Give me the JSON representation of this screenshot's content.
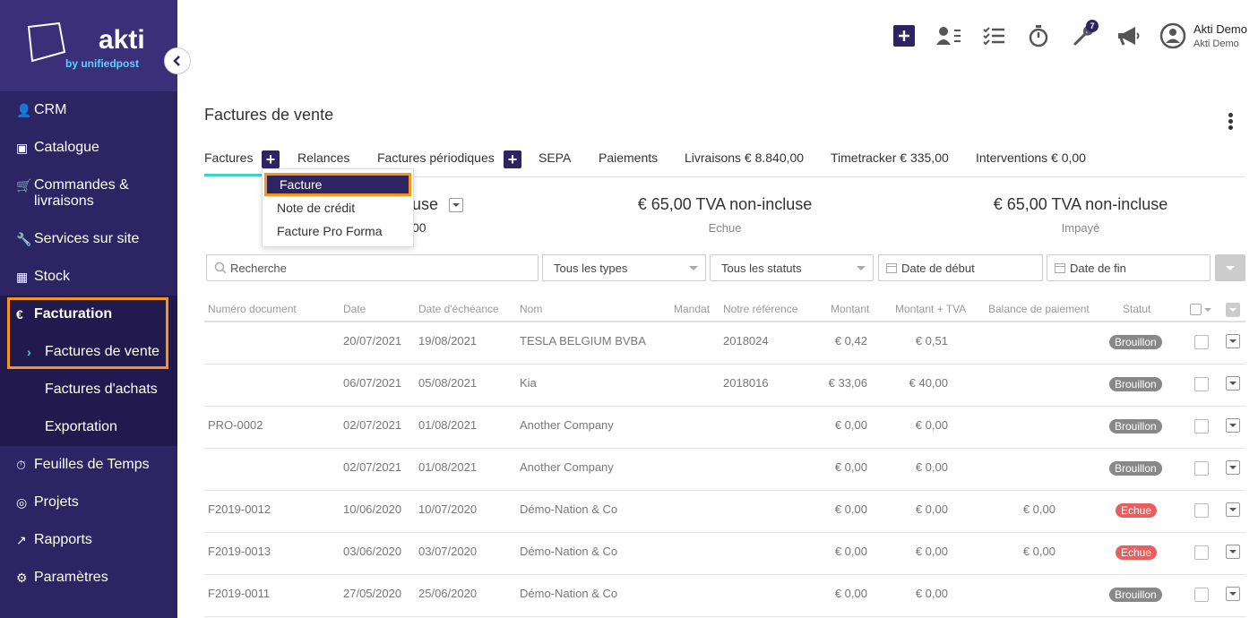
{
  "brand": {
    "name": "akti",
    "tagline": "by unifiedpost"
  },
  "sidebar": {
    "items": [
      {
        "id": "crm",
        "label": "CRM",
        "icon": "user-icon"
      },
      {
        "id": "catalogue",
        "label": "Catalogue",
        "icon": "book-icon"
      },
      {
        "id": "commandes",
        "label": "Commandes & livraisons",
        "icon": "cart-icon"
      },
      {
        "id": "services",
        "label": "Services sur site",
        "icon": "wrench-icon"
      },
      {
        "id": "stock",
        "label": "Stock",
        "icon": "cubes-icon"
      },
      {
        "id": "facturation",
        "label": "Facturation",
        "icon": "euro-icon"
      },
      {
        "id": "factures-vente",
        "label": "Factures de vente",
        "icon": "chevron-right-icon"
      },
      {
        "id": "factures-achats",
        "label": "Factures d'achats"
      },
      {
        "id": "exportation",
        "label": "Exportation"
      },
      {
        "id": "feuilles",
        "label": "Feuilles de Temps",
        "icon": "stopwatch-icon"
      },
      {
        "id": "projets",
        "label": "Projets",
        "icon": "target-icon"
      },
      {
        "id": "rapports",
        "label": "Rapports",
        "icon": "chart-icon"
      },
      {
        "id": "parametres",
        "label": "Paramètres",
        "icon": "gear-icon"
      }
    ]
  },
  "header": {
    "badge_count": "7",
    "user_name": "Akti Demo",
    "user_company": "Akti Demo"
  },
  "page": {
    "title": "Factures de vente"
  },
  "tabs": [
    {
      "label": "Factures"
    },
    {
      "label": "Relances"
    },
    {
      "label": "Factures périodiques"
    },
    {
      "label": "SEPA"
    },
    {
      "label": "Paiements"
    },
    {
      "label": "Livraisons € 8.840,00"
    },
    {
      "label": "Timetracker € 335,00"
    },
    {
      "label": "Interventions € 0,00"
    }
  ],
  "dropdown": {
    "items": [
      "Facture",
      "Note de crédit",
      "Facture Pro Forma"
    ]
  },
  "summary": {
    "partial_main": "use",
    "partial_sub": "00",
    "echue_amount": "€ 65,00 TVA non-incluse",
    "echue_label": "Echue",
    "impaye_amount": "€ 65,00 TVA non-incluse",
    "impaye_label": "Impayé"
  },
  "filters": {
    "search_placeholder": "Recherche",
    "types": "Tous les types",
    "statuts": "Tous les statuts",
    "date_debut": "Date de début",
    "date_fin": "Date de fin"
  },
  "table": {
    "headers": {
      "numero": "Numéro document",
      "date": "Date",
      "echeance": "Date d'échéance",
      "nom": "Nom",
      "mandat": "Mandat",
      "reference": "Notre référence",
      "montant": "Montant",
      "montant_tva": "Montant + TVA",
      "balance": "Balance de paiement",
      "statut": "Statut"
    },
    "rows": [
      {
        "numero": "",
        "date": "20/07/2021",
        "echeance": "19/08/2021",
        "nom": "TESLA BELGIUM BVBA",
        "reference": "2018024",
        "montant": "€ 0,42",
        "montant_tva": "€ 0,51",
        "balance": "",
        "statut": "Brouillon"
      },
      {
        "numero": "",
        "date": "06/07/2021",
        "echeance": "05/08/2021",
        "nom": "Kia",
        "reference": "2018016",
        "montant": "€ 33,06",
        "montant_tva": "€ 40,00",
        "balance": "",
        "statut": "Brouillon"
      },
      {
        "numero": "PRO-0002",
        "date": "02/07/2021",
        "echeance": "01/08/2021",
        "nom": "Another Company",
        "reference": "",
        "montant": "€ 0,00",
        "montant_tva": "€ 0,00",
        "balance": "",
        "statut": "Brouillon"
      },
      {
        "numero": "",
        "date": "02/07/2021",
        "echeance": "01/08/2021",
        "nom": "Another Company",
        "reference": "",
        "montant": "€ 0,00",
        "montant_tva": "€ 0,00",
        "balance": "",
        "statut": "Brouillon"
      },
      {
        "numero": "F2019-0012",
        "date": "10/06/2020",
        "echeance": "10/07/2020",
        "nom": "Démo-Nation & Co",
        "reference": "",
        "montant": "€ 0,00",
        "montant_tva": "€ 0,00",
        "balance": "€ 0,00",
        "statut": "Echue"
      },
      {
        "numero": "F2019-0013",
        "date": "03/06/2020",
        "echeance": "03/07/2020",
        "nom": "Démo-Nation & Co",
        "reference": "",
        "montant": "€ 0,00",
        "montant_tva": "€ 0,00",
        "balance": "€ 0,00",
        "statut": "Echue"
      },
      {
        "numero": "F2019-0011",
        "date": "27/05/2020",
        "echeance": "25/06/2020",
        "nom": "Démo-Nation & Co",
        "reference": "",
        "montant": "€ 0,00",
        "montant_tva": "€ 0,00",
        "balance": "",
        "statut": "Brouillon"
      }
    ]
  },
  "colors": {
    "sidebar": "#2d2463",
    "accent": "#3fd2c7",
    "highlight": "#f7941d",
    "echue": "#e85f5f",
    "brouillon": "#888888"
  }
}
